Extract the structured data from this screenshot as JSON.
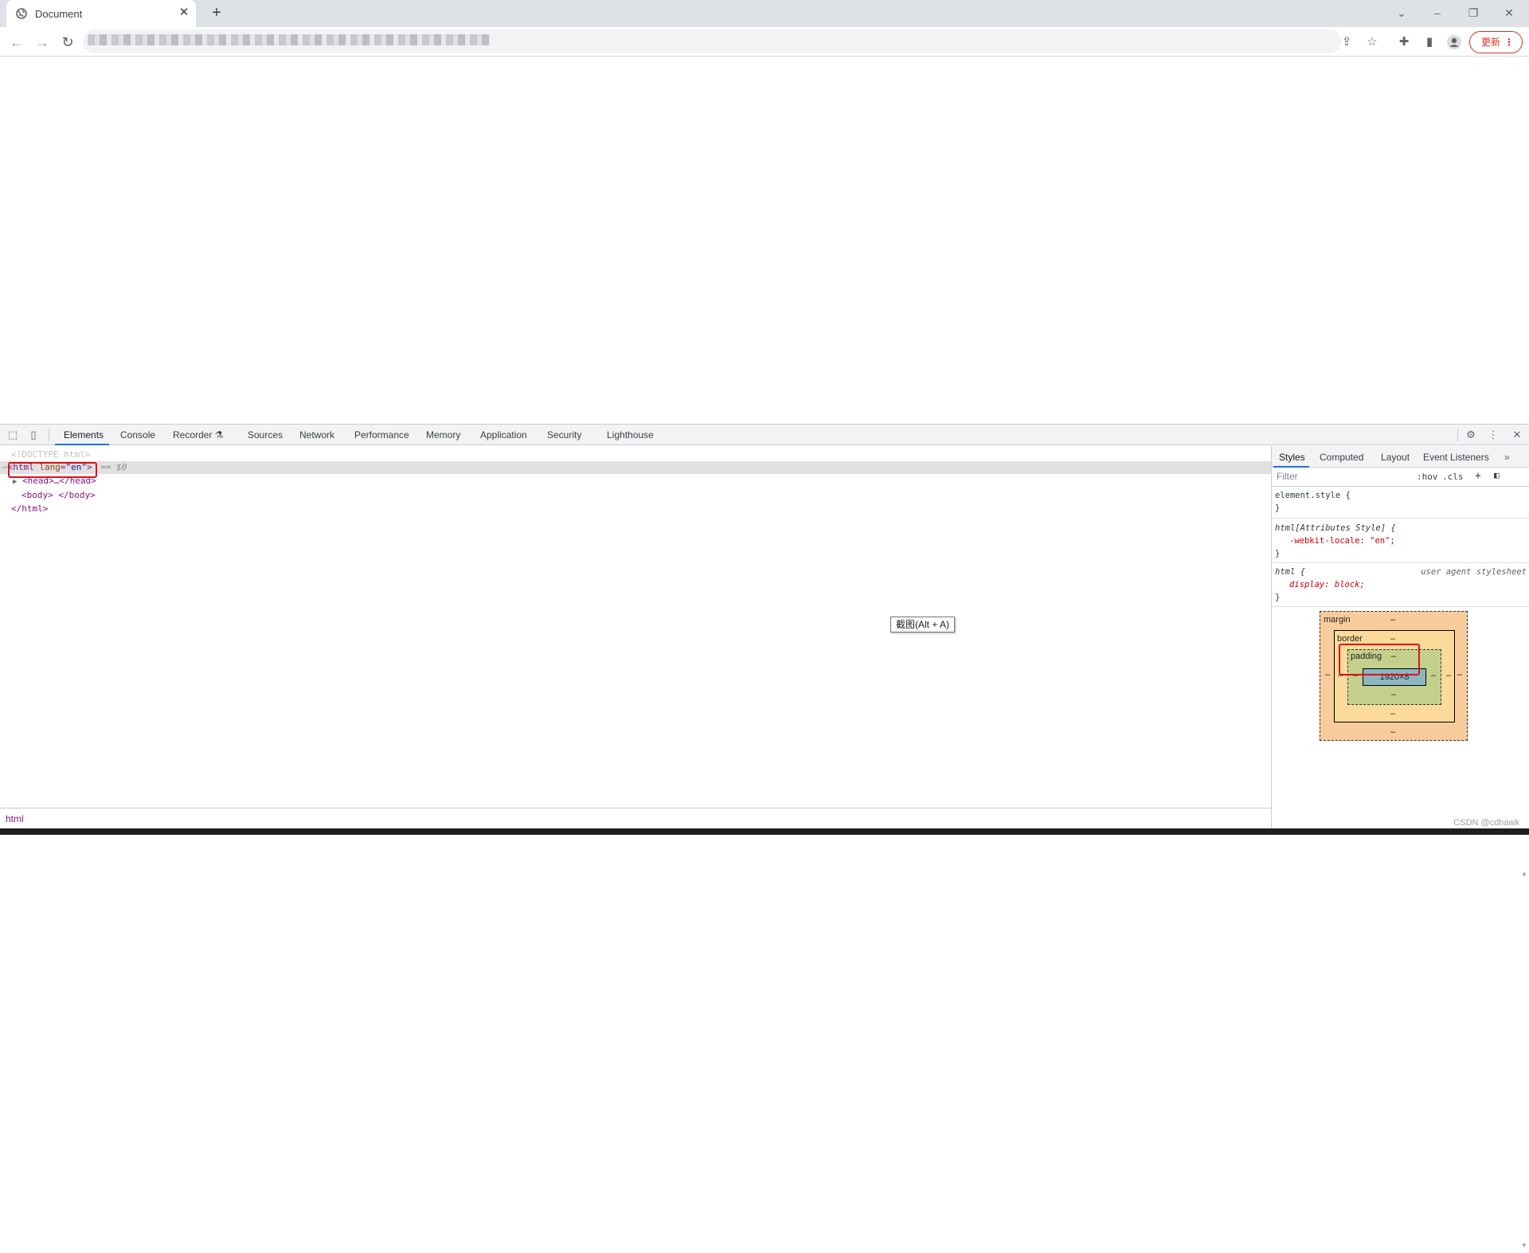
{
  "browser": {
    "tab_title": "Document",
    "update_label": "更新"
  },
  "devtools": {
    "tabs": [
      "Elements",
      "Console",
      "Recorder",
      "Sources",
      "Network",
      "Performance",
      "Memory",
      "Application",
      "Security",
      "Lighthouse"
    ],
    "active_tab": "Elements",
    "dom": {
      "doctype": "<!DOCTYPE html>",
      "html_open_tag": "html",
      "html_attr_name": "lang",
      "html_attr_value": "\"en\"",
      "selected_marker": "== $0",
      "head": "<head>…</head>",
      "body": "<body> </body>",
      "html_close": "</html>"
    },
    "breadcrumb": "html",
    "styles_tabs": [
      "Styles",
      "Computed",
      "Layout",
      "Event Listeners"
    ],
    "filter_placeholder": "Filter",
    "hov_label": ":hov",
    "cls_label": ".cls",
    "rules": {
      "r1_selector": "element.style {",
      "r1_close": "}",
      "r2_selector": "html[Attributes Style] {",
      "r2_prop": "-webkit-locale: \"en\";",
      "r2_close": "}",
      "r3_selector": "html {",
      "r3_source": "user agent stylesheet",
      "r3_prop": "display: block;",
      "r3_close": "}"
    },
    "box_model": {
      "margin_label": "margin",
      "border_label": "border",
      "padding_label": "padding",
      "dash": "–",
      "content_size": "1920×8"
    }
  },
  "overlay": {
    "screenshot_tip": "截图(Alt + A)"
  },
  "watermark": "CSDN @cdhawk"
}
